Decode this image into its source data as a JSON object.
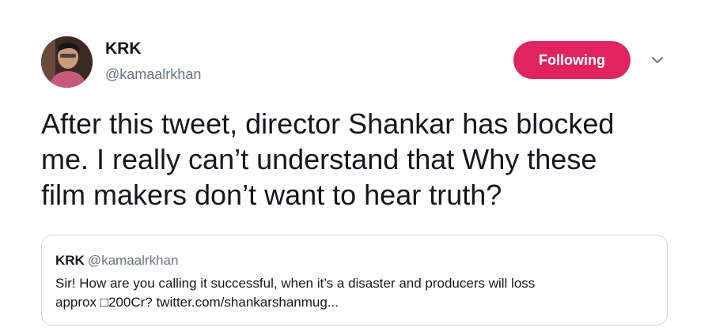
{
  "author": {
    "display_name": "KRK",
    "handle": "@kamaalrkhan"
  },
  "follow_button": {
    "label": "Following",
    "color": "#e0245e"
  },
  "tweet": {
    "lines": [
      "After this tweet, director Shankar has blocked",
      "me. I really can’t understand that Why these",
      "film makers don’t want to hear truth?"
    ]
  },
  "quoted_tweet": {
    "display_name": "KRK",
    "handle": "@kamaalrkhan",
    "lines": [
      "Sir! How are you calling it successful, when it’s a disaster and producers will loss",
      "approx □200Cr? twitter.com/shankarshanmug..."
    ]
  },
  "icons": {
    "caret": "chevron-down-icon",
    "avatar": "profile-photo"
  }
}
